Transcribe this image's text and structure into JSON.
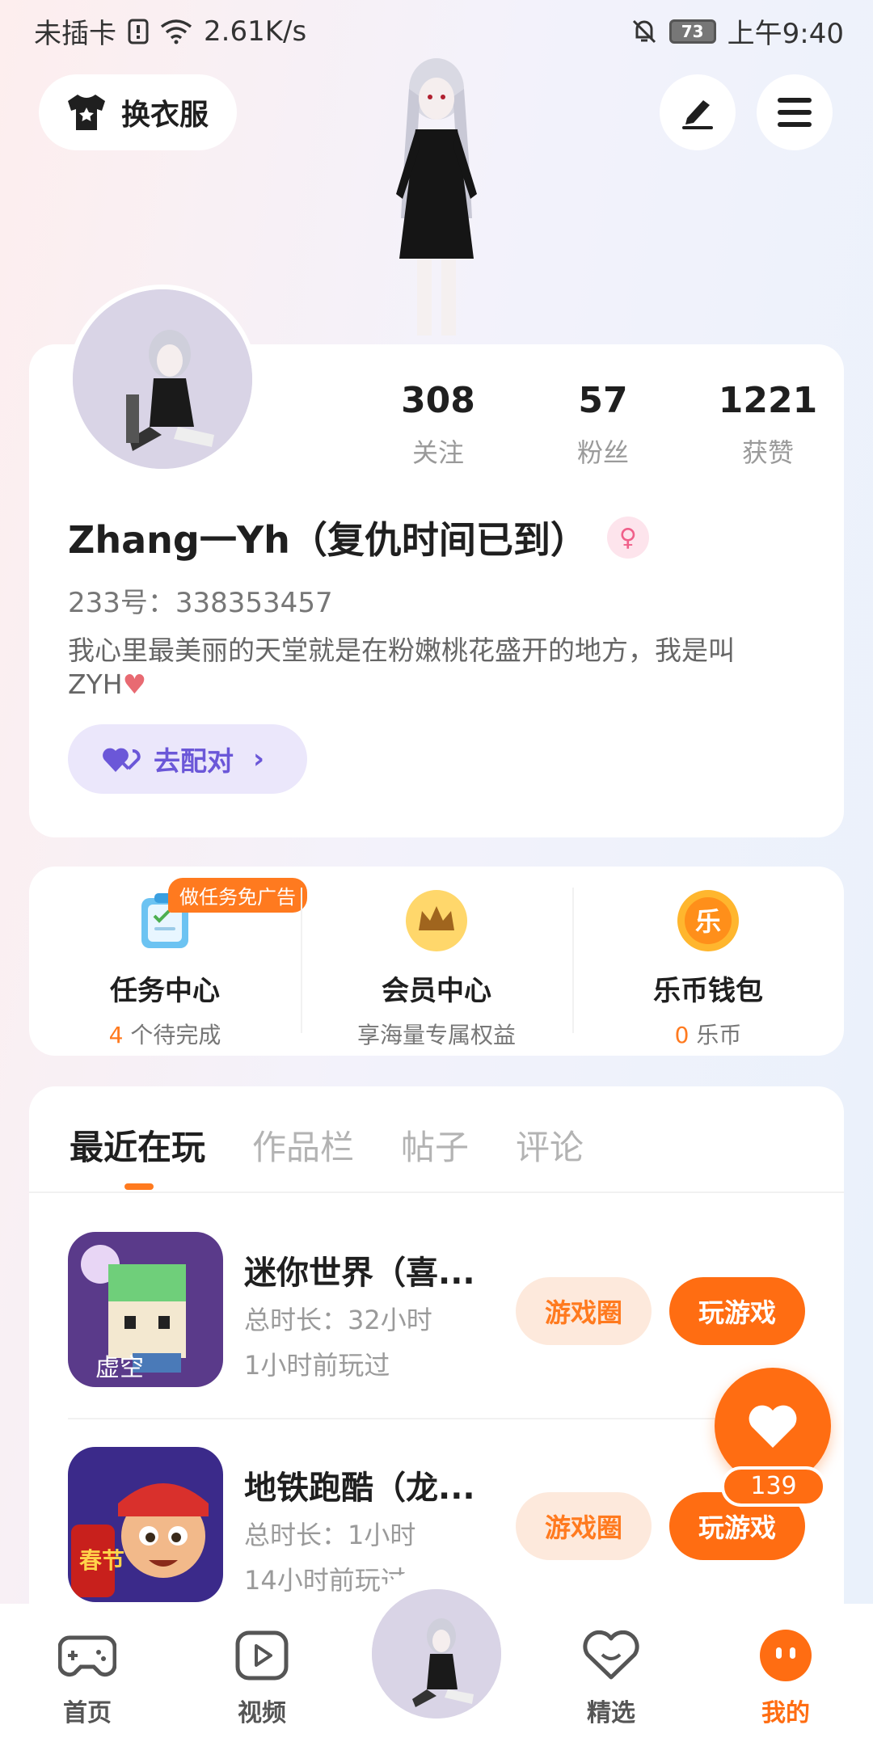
{
  "status_bar": {
    "carrier": "未插卡",
    "speed": "2.61K/s",
    "battery": "73",
    "time": "上午9:40"
  },
  "top": {
    "outfit_label": "换衣服"
  },
  "profile": {
    "stats": [
      {
        "num": "308",
        "label": "关注"
      },
      {
        "num": "57",
        "label": "粉丝"
      },
      {
        "num": "1221",
        "label": "获赞"
      }
    ],
    "username": "Zhang一Yh（复仇时间已到）",
    "uid": "233号：338353457",
    "bio": "我心里最美丽的天堂就是在粉嫩桃花盛开的地方，我是叫ZYH",
    "match_label": "去配对"
  },
  "services": [
    {
      "title": "任务中心",
      "count": "4",
      "sub": " 个待完成",
      "badge": "做任务免广告"
    },
    {
      "title": "会员中心",
      "sub": "享海量专属权益"
    },
    {
      "title": "乐币钱包",
      "count": "0",
      "sub": " 乐币"
    }
  ],
  "tabs": [
    "最近在玩",
    "作品栏",
    "帖子",
    "评论"
  ],
  "games": [
    {
      "name": "迷你世界（喜...",
      "time": "总时长：32小时",
      "last": "1小时前玩过",
      "circle": "游戏圈",
      "play": "玩游戏"
    },
    {
      "name": "地铁跑酷（龙...",
      "time": "总时长：1小时",
      "last": "14小时前玩过",
      "circle": "游戏圈",
      "play": "玩游戏"
    }
  ],
  "like_count": "139",
  "nav": [
    "首页",
    "视频",
    "精选",
    "我的"
  ],
  "colors": {
    "accent": "#ff6d12",
    "purple": "#6b57d8"
  }
}
